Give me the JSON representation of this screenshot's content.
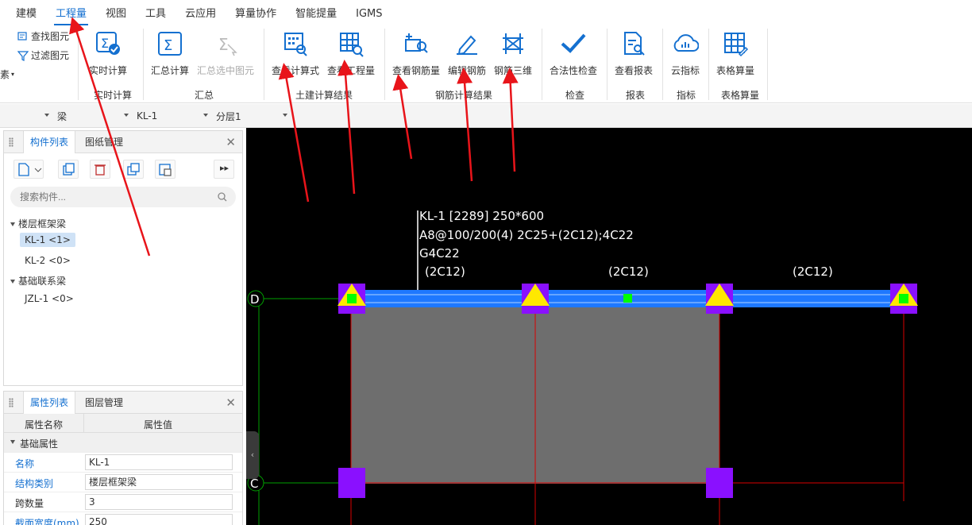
{
  "menu": [
    {
      "label": "建模",
      "active": false
    },
    {
      "label": "工程量",
      "active": true
    },
    {
      "label": "视图",
      "active": false
    },
    {
      "label": "工具",
      "active": false
    },
    {
      "label": "云应用",
      "active": false
    },
    {
      "label": "算量协作",
      "active": false
    },
    {
      "label": "智能提量",
      "active": false
    },
    {
      "label": "IGMS",
      "active": false
    }
  ],
  "ribbon": {
    "left_small": {
      "find": "查找图元",
      "filter": "过滤图元",
      "cut_fragment": "素"
    },
    "realtime": {
      "btn": "实时计算",
      "group": "实时计算"
    },
    "summary": {
      "sum": "汇总计算",
      "sum_selected": "汇总选中图元",
      "group": "汇总"
    },
    "civil": {
      "view_formula": "查看计算式",
      "view_quantity": "查看工程量",
      "group": "土建计算结果"
    },
    "rebar": {
      "view_rebar": "查看钢筋量",
      "edit_rebar": "编辑钢筋",
      "rebar_3d": "钢筋三维",
      "group": "钢筋计算结果"
    },
    "check": {
      "btn": "合法性检查",
      "group": "检查"
    },
    "report": {
      "btn": "查看报表",
      "group": "报表"
    },
    "index": {
      "btn": "云指标",
      "group": "指标"
    },
    "table": {
      "btn": "表格算量",
      "group": "表格算量"
    }
  },
  "toolbar": {
    "combo1": "",
    "combo2": "梁",
    "combo3": "KL-1",
    "combo4": "分层1"
  },
  "component_panel": {
    "tab_active": "构件列表",
    "tab_other": "图纸管理",
    "search_placeholder": "搜索构件...",
    "tree": [
      {
        "label": "楼层框架梁",
        "level": 0
      },
      {
        "label": "KL-1 <1>",
        "level": 1,
        "selected": true
      },
      {
        "label": "KL-2 <0>",
        "level": 1
      },
      {
        "label": "基础联系梁",
        "level": 0
      },
      {
        "label": "JZL-1 <0>",
        "level": 1
      }
    ]
  },
  "property_panel": {
    "tab_active": "属性列表",
    "tab_other": "图层管理",
    "col_name": "属性名称",
    "col_value": "属性值",
    "section": "基础属性",
    "rows": [
      {
        "name": "名称",
        "value": "KL-1"
      },
      {
        "name": "结构类别",
        "value": "楼层框架梁"
      },
      {
        "name": "跨数量",
        "value": "3"
      },
      {
        "name": "截面宽度(mm)",
        "value": "250"
      }
    ]
  },
  "canvas": {
    "annotation": [
      "KL-1 [2289] 250*600",
      "A8@100/200(4) 2C25+(2C12);4C22",
      "G4C22"
    ],
    "span_labels": [
      "(2C12)",
      "(2C12)",
      "(2C12)"
    ],
    "axis_labels": [
      "D",
      "C"
    ]
  },
  "colors": {
    "accent": "#1470d0",
    "arrow": "#e8141a",
    "beam": "#1e78ff",
    "column": "#8a10ff",
    "support": "#ffe800",
    "grid_red": "#d80000",
    "grid_green": "#00a000"
  }
}
